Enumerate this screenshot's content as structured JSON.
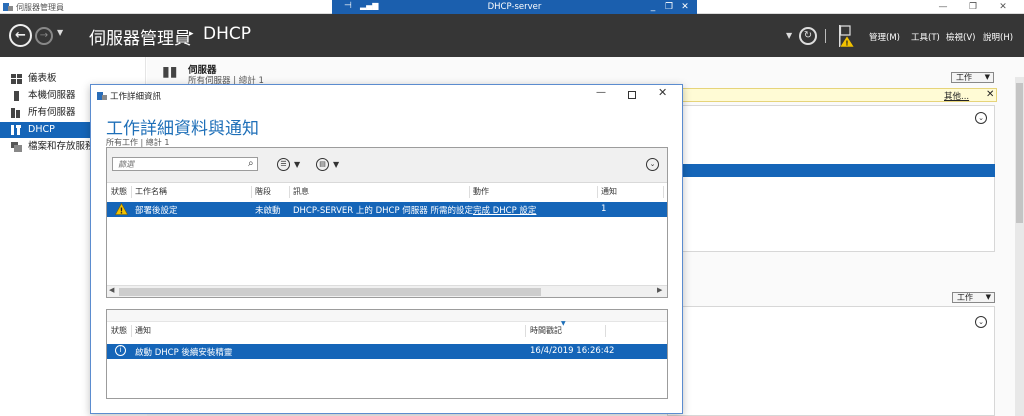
{
  "outer_window": {
    "title": "伺服器管理員",
    "controls": [
      "—",
      "❐",
      "✕"
    ]
  },
  "rdp": {
    "title": "DHCP-server",
    "pin_icon": "pin-icon",
    "signal_icon": "signal-icon",
    "controls": [
      "_",
      "❐",
      "✕"
    ]
  },
  "header": {
    "breadcrumb_root": "伺服器管理員",
    "breadcrumb_sep": "▸",
    "breadcrumb_leaf": "DHCP",
    "menus": [
      "管理(M)",
      "工具(T)",
      "檢視(V)",
      "說明(H)"
    ]
  },
  "sidebar": {
    "items": [
      {
        "label": "儀表板",
        "icon": "dashboard-icon",
        "selected": false
      },
      {
        "label": "本機伺服器",
        "icon": "local-server-icon",
        "selected": false
      },
      {
        "label": "所有伺服器",
        "icon": "all-servers-icon",
        "selected": false
      },
      {
        "label": "DHCP",
        "icon": "dhcp-icon",
        "selected": true
      },
      {
        "label": "檔案和存放服務",
        "icon": "file-storage-icon",
        "selected": false
      }
    ]
  },
  "content": {
    "servers_title": "伺服器",
    "servers_sub": "所有伺服器 | 總計 1",
    "task_label": "工作",
    "task_label_2": "工作",
    "info_other": "其他...",
    "info_close": "✕"
  },
  "dialog": {
    "title": "工作詳細資訊",
    "heading": "工作詳細資料與通知",
    "subheading": "所有工作 | 總計 1",
    "filter_placeholder": "篩選",
    "task_columns": [
      "狀態",
      "工作名稱",
      "階段",
      "訊息",
      "動作",
      "通知"
    ],
    "task_row": {
      "name": "部署後設定",
      "stage": "未啟動",
      "message": "DHCP-SERVER 上的 DHCP 伺服器 所需的設定",
      "action": "完成 DHCP 設定",
      "notifications": "1"
    },
    "notif_columns": [
      "狀態",
      "通知",
      "時間戳記"
    ],
    "notif_row": {
      "text": "啟動 DHCP 後續安裝精靈",
      "timestamp": "16/4/2019 16:26:42"
    }
  },
  "colors": {
    "accent": "#1565b8",
    "header_bg": "#363636",
    "heading_blue": "#1e6fb8",
    "warning": "#f2c200"
  }
}
